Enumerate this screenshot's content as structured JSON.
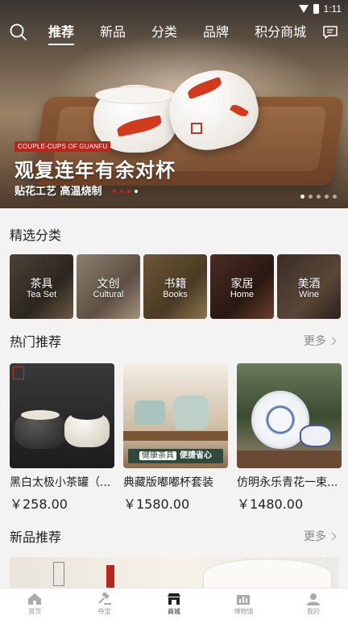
{
  "status_bar": {
    "time": "1:11"
  },
  "nav": {
    "tabs": [
      {
        "label": "推荐",
        "active": true
      },
      {
        "label": "新品",
        "active": false
      },
      {
        "label": "分类",
        "active": false
      },
      {
        "label": "品牌",
        "active": false
      },
      {
        "label": "积分商城",
        "active": false
      }
    ],
    "search_icon": "search-icon",
    "message_icon": "message-icon"
  },
  "hero": {
    "badge": "COUPLE-CUPS OF GUANFU",
    "title": "观复连年有余对杯",
    "subtitle": "贴花工艺 高温烧制",
    "page_count": 5,
    "active_page": 1
  },
  "categories": {
    "title": "精选分类",
    "items": [
      {
        "cn": "茶具",
        "en": "Tea Set"
      },
      {
        "cn": "文创",
        "en": "Cultural"
      },
      {
        "cn": "书籍",
        "en": "Books"
      },
      {
        "cn": "家居",
        "en": "Home"
      },
      {
        "cn": "美酒",
        "en": "Wine"
      }
    ]
  },
  "hot": {
    "title": "热门推荐",
    "more": "更多",
    "products": [
      {
        "name": "黑白太极小茶罐（...",
        "price": "￥258.00"
      },
      {
        "name": "典藏版嘟嘟杯套装",
        "price": "￥1580.00",
        "tag_left": "健康茶具",
        "tag_right": "便捷省心"
      },
      {
        "name": "仿明永乐青花一束...",
        "price": "￥1480.00"
      }
    ]
  },
  "new": {
    "title": "新品推荐",
    "more": "更多"
  },
  "bottom_nav": [
    {
      "label": "首页",
      "icon": "home-icon",
      "active": false
    },
    {
      "label": "夺宝",
      "icon": "gavel-icon",
      "active": false
    },
    {
      "label": "商城",
      "icon": "shop-icon",
      "active": true
    },
    {
      "label": "博物馆",
      "icon": "museum-icon",
      "active": false
    },
    {
      "label": "我的",
      "icon": "user-icon",
      "active": false
    }
  ],
  "colors": {
    "accent": "#b6281e",
    "text": "#222222",
    "muted": "#888888"
  }
}
